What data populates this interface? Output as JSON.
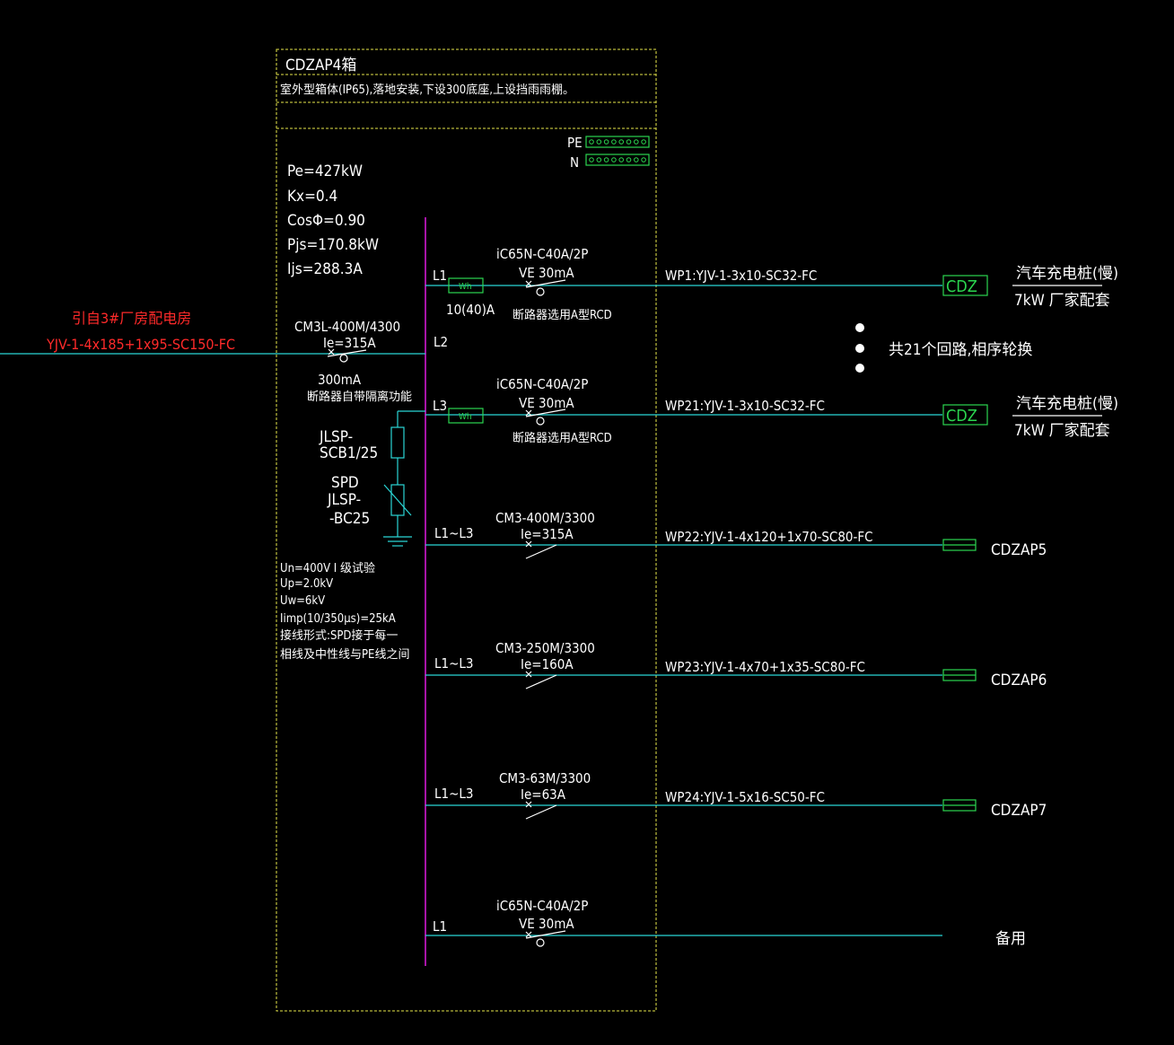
{
  "panel": {
    "title": "CDZAP4箱",
    "description": "室外型箱体(IP65),落地安装,下设300底座,上设挡雨雨棚。",
    "pe_label": "PE",
    "n_label": "N",
    "params": [
      "Pe=427kW",
      "Kx=0.4",
      "CosΦ=0.90",
      "Pjs=170.8kW",
      "Ijs=288.3A"
    ]
  },
  "incoming": {
    "source": "引自3#厂房配电房",
    "cable": "YJV-1-4x185+1x95-SC150-FC",
    "breaker_model": "CM3L-400M/4300",
    "breaker_current": "Ie=315A",
    "rcd": "300mA",
    "breaker_note": "断路器自带隔离功能"
  },
  "spd": {
    "fuse_line1": "JLSP-",
    "fuse_line2": "SCB1/25",
    "spd_line1": "SPD",
    "spd_line2": "JLSP-",
    "spd_line3": "-BC25",
    "notes": [
      "Un=400V    I 级试验",
      "Up=2.0kV",
      "Uw=6kV",
      "Iimp(10/350μs)=25kA",
      "接线形式:SPD接于每一",
      "相线及中性线与PE线之间"
    ]
  },
  "circuits": [
    {
      "phase": "L1",
      "breaker_model": "iC65N-C40A/2P",
      "breaker_rating": "VE 30mA",
      "meter": "Wh",
      "meter_rating": "10(40)A",
      "note": "断路器选用A型RCD",
      "cable": "WP1:YJV-1-3x10-SC32-FC",
      "load": "CDZ",
      "load_desc1": "汽车充电桩(慢)",
      "load_desc2": "7kW 厂家配套"
    },
    {
      "phase": "L3",
      "breaker_model": "iC65N-C40A/2P",
      "breaker_rating": "VE 30mA",
      "meter": "Wh",
      "note": "断路器选用A型RCD",
      "cable": "WP21:YJV-1-3x10-SC32-FC",
      "load": "CDZ",
      "load_desc1": "汽车充电桩(慢)",
      "load_desc2": "7kW 厂家配套"
    },
    {
      "phase": "L1~L3",
      "breaker_model": "CM3-400M/3300",
      "breaker_rating": "Ie=315A",
      "cable": "WP22:YJV-1-4x120+1x70-SC80-FC",
      "load": "CDZAP5"
    },
    {
      "phase": "L1~L3",
      "breaker_model": "CM3-250M/3300",
      "breaker_rating": "Ie=160A",
      "cable": "WP23:YJV-1-4x70+1x35-SC80-FC",
      "load": "CDZAP6"
    },
    {
      "phase": "L1~L3",
      "breaker_model": "CM3-63M/3300",
      "breaker_rating": "Ie=63A",
      "cable": "WP24:YJV-1-5x16-SC50-FC",
      "load": "CDZAP7"
    },
    {
      "phase": "L1",
      "breaker_model": "iC65N-C40A/2P",
      "breaker_rating": "VE 30mA",
      "cable": "",
      "load": "备用"
    }
  ],
  "l2_label": "L2",
  "circuit_count_note": "共21个回路,相序轮换",
  "colors": {
    "background": "#000000",
    "wire": "#2ad6d6",
    "busbar": "#d21ad2",
    "frame": "#e6e64a",
    "load_box": "#2bd64f",
    "incoming_text": "#ff2a2a",
    "text": "#ffffff"
  }
}
